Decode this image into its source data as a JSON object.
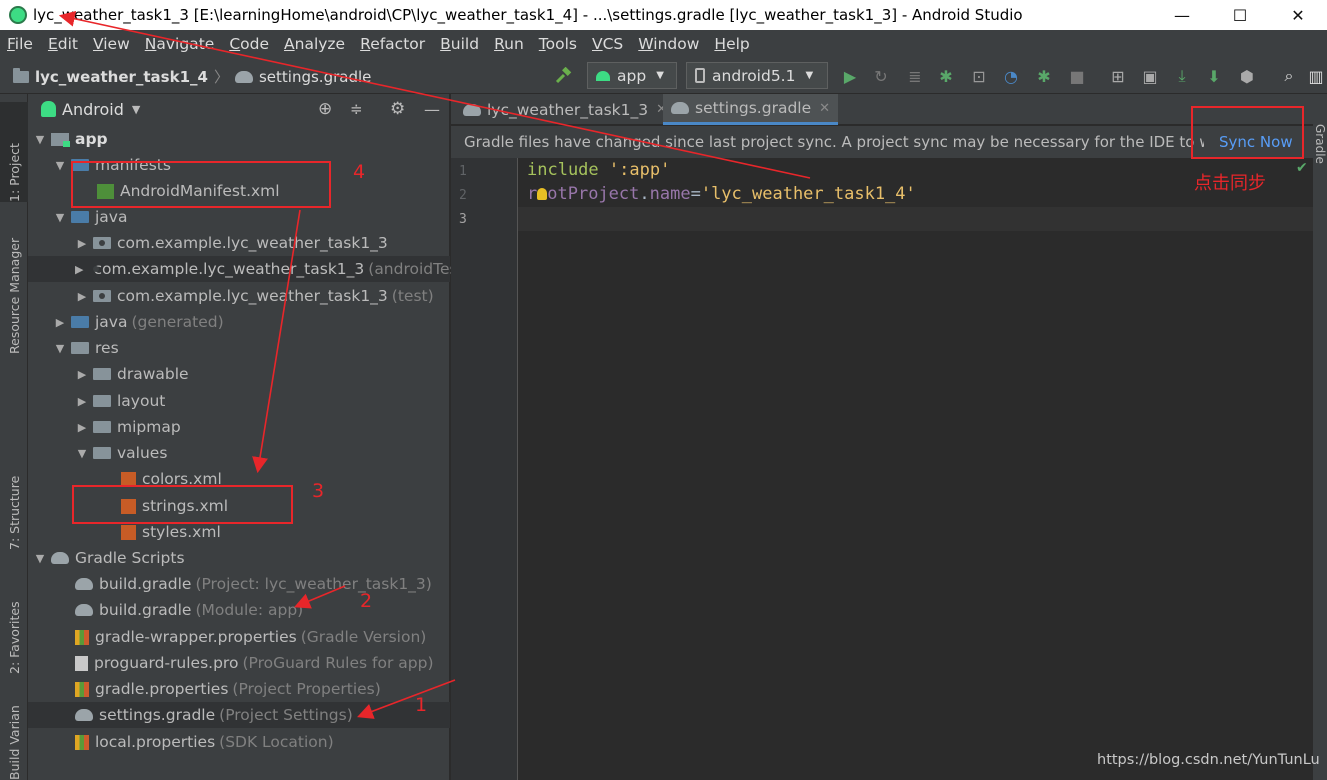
{
  "window": {
    "title": "lyc_weather_task1_3 [E:\\learningHome\\android\\CP\\lyc_weather_task1_4] - ...\\settings.gradle [lyc_weather_task1_3] - Android Studio",
    "minimize": "—",
    "maximize": "☐",
    "close": "✕"
  },
  "menu": [
    "File",
    "Edit",
    "View",
    "Navigate",
    "Code",
    "Analyze",
    "Refactor",
    "Build",
    "Run",
    "Tools",
    "VCS",
    "Window",
    "Help"
  ],
  "breadcrumb": {
    "project": "lyc_weather_task1_4",
    "separator": "〉",
    "file": "settings.gradle"
  },
  "toolbar": {
    "config": "app",
    "device": "android5.1"
  },
  "tool_windows": {
    "project": "1: Project",
    "resource_manager": "Resource Manager",
    "structure": "7: Structure",
    "favorites": "2: Favorites",
    "build_variants": "Build Variants",
    "gradle": "Gradle"
  },
  "project_panel": {
    "view_mode": "Android",
    "tree": [
      {
        "label": "app",
        "hint": ""
      },
      {
        "label": "manifests",
        "hint": ""
      },
      {
        "label": "AndroidManifest.xml",
        "hint": ""
      },
      {
        "label": "java",
        "hint": ""
      },
      {
        "label": "com.example.lyc_weather_task1_3",
        "hint": ""
      },
      {
        "label": "com.example.lyc_weather_task1_3",
        "hint": "(androidTest)"
      },
      {
        "label": "com.example.lyc_weather_task1_3",
        "hint": "(test)"
      },
      {
        "label": "java",
        "hint": "(generated)"
      },
      {
        "label": "res",
        "hint": ""
      },
      {
        "label": "drawable",
        "hint": ""
      },
      {
        "label": "layout",
        "hint": ""
      },
      {
        "label": "mipmap",
        "hint": ""
      },
      {
        "label": "values",
        "hint": ""
      },
      {
        "label": "colors.xml",
        "hint": ""
      },
      {
        "label": "strings.xml",
        "hint": ""
      },
      {
        "label": "styles.xml",
        "hint": ""
      },
      {
        "label": "Gradle Scripts",
        "hint": ""
      },
      {
        "label": "build.gradle",
        "hint": "(Project: lyc_weather_task1_3)"
      },
      {
        "label": "build.gradle",
        "hint": "(Module: app)"
      },
      {
        "label": "gradle-wrapper.properties",
        "hint": "(Gradle Version)"
      },
      {
        "label": "proguard-rules.pro",
        "hint": "(ProGuard Rules for app)"
      },
      {
        "label": "gradle.properties",
        "hint": "(Project Properties)"
      },
      {
        "label": "settings.gradle",
        "hint": "(Project Settings)"
      },
      {
        "label": "local.properties",
        "hint": "(SDK Location)"
      }
    ]
  },
  "editor": {
    "tabs": [
      {
        "label": "lyc_weather_task1_3"
      },
      {
        "label": "settings.gradle"
      }
    ],
    "banner": "Gradle files have changed since last project sync. A project sync may be necessary for the IDE to work properly.",
    "sync_action": "Sync Now",
    "line_numbers": [
      "1",
      "2",
      "3"
    ],
    "code": {
      "line1_kw": "include",
      "line1_str": "':app'",
      "line2_r": "r",
      "line2_rest": "otProject",
      "line2_dot": ".",
      "line2_prop": "name",
      "line2_eq": "=",
      "line2_str": "'lyc_weather_task1_4'"
    }
  },
  "annotations": {
    "label_1": "1",
    "label_2": "2",
    "label_3": "3",
    "label_4": "4",
    "sync_hint": "点击同步",
    "color": "#e8262a"
  },
  "watermark": "https://blog.csdn.net/YunTunLu"
}
